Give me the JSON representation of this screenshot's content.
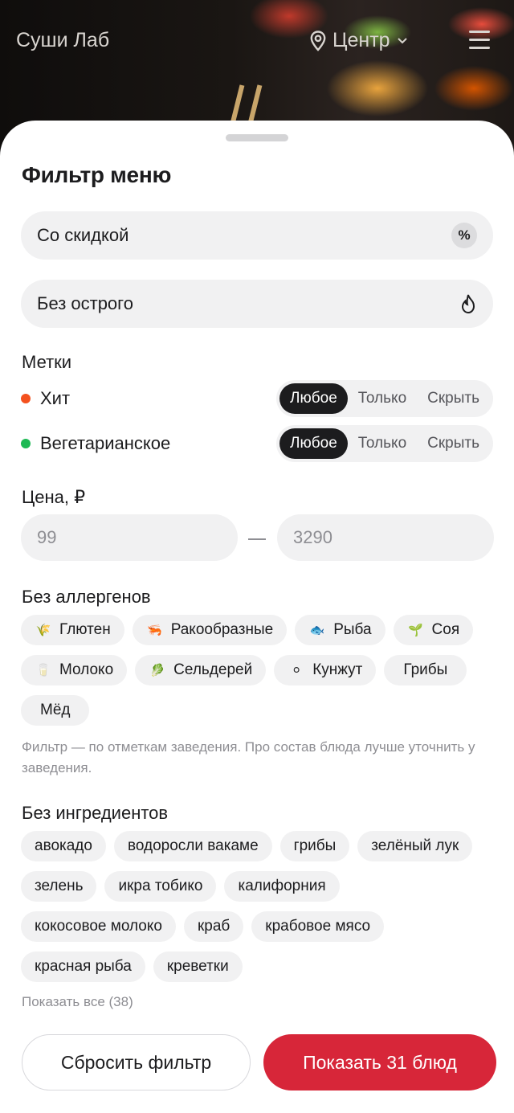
{
  "header": {
    "brand": "Суши Лаб",
    "location": "Центр"
  },
  "sheet": {
    "title": "Фильтр меню",
    "toggles": [
      {
        "label": "Со скидкой",
        "icon": "percent-icon"
      },
      {
        "label": "Без острого",
        "icon": "flame-icon"
      }
    ],
    "tags_title": "Метки",
    "tags": [
      {
        "label": "Хит",
        "color": "#f4511e",
        "options": [
          "Любое",
          "Только",
          "Скрыть"
        ],
        "selected": "Любое"
      },
      {
        "label": "Вегетарианское",
        "color": "#1db954",
        "options": [
          "Любое",
          "Только",
          "Скрыть"
        ],
        "selected": "Любое"
      }
    ],
    "price_title": "Цена, ₽",
    "price_min_placeholder": "99",
    "price_max_placeholder": "3290",
    "allergens_title": "Без аллергенов",
    "allergens": [
      {
        "label": "Глютен",
        "icon": "wheat-icon"
      },
      {
        "label": "Ракообразные",
        "icon": "shrimp-icon"
      },
      {
        "label": "Рыба",
        "icon": "fish-icon"
      },
      {
        "label": "Соя",
        "icon": "sprout-icon"
      },
      {
        "label": "Молоко",
        "icon": "milk-icon"
      },
      {
        "label": "Сельдерей",
        "icon": "celery-icon"
      },
      {
        "label": "Кунжут",
        "icon": "sesame-icon"
      },
      {
        "label": "Грибы",
        "icon": ""
      },
      {
        "label": "Мёд",
        "icon": ""
      }
    ],
    "allergens_note": "Фильтр — по отметкам заведения. Про состав блюда лучше уточнить у заведения.",
    "ingredients_title": "Без ингредиентов",
    "ingredients": [
      "авокадо",
      "водоросли вакаме",
      "грибы",
      "зелёный лук",
      "зелень",
      "икра тобико",
      "калифорния",
      "кокосовое молоко",
      "краб",
      "крабовое мясо",
      "красная рыба",
      "креветки"
    ],
    "show_all": "Показать все (38)",
    "reset_label": "Сбросить фильтр",
    "show_label": "Показать 31 блюд"
  }
}
